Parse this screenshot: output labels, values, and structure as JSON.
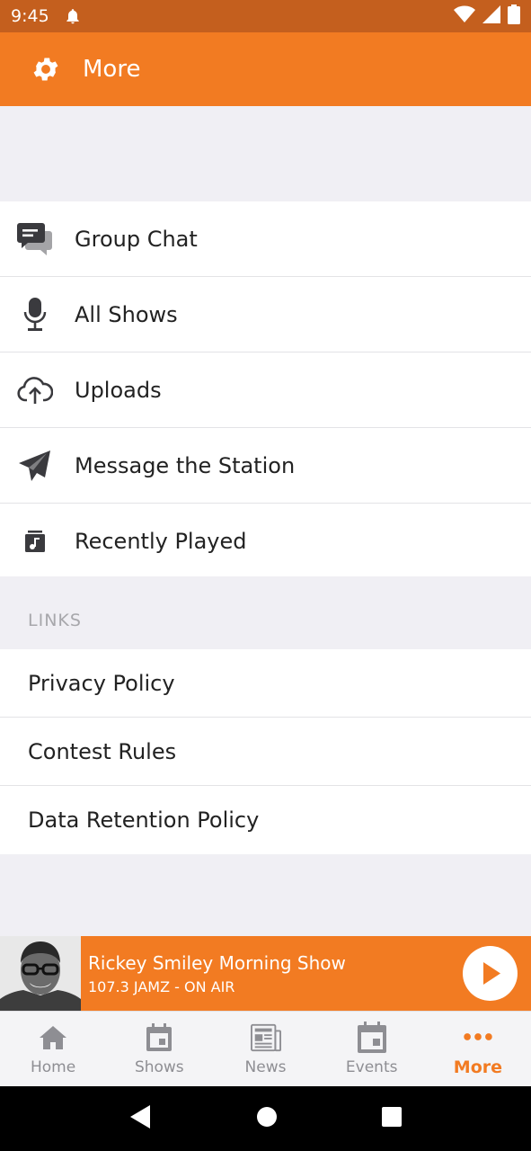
{
  "status": {
    "time": "9:45"
  },
  "header": {
    "title": "More"
  },
  "menu": [
    {
      "label": "Group Chat",
      "icon": "chat-icon"
    },
    {
      "label": "All Shows",
      "icon": "microphone-icon"
    },
    {
      "label": "Uploads",
      "icon": "cloud-upload-icon"
    },
    {
      "label": "Message the Station",
      "icon": "paper-plane-icon"
    },
    {
      "label": "Recently Played",
      "icon": "music-note-icon"
    }
  ],
  "links": {
    "header": "LINKS",
    "items": [
      {
        "label": "Privacy Policy"
      },
      {
        "label": "Contest Rules"
      },
      {
        "label": "Data Retention Policy"
      }
    ]
  },
  "player": {
    "show": "Rickey Smiley Morning Show",
    "station": "107.3 JAMZ - ON AIR"
  },
  "tabs": [
    {
      "label": "Home",
      "icon": "home-icon"
    },
    {
      "label": "Shows",
      "icon": "calendar-icon"
    },
    {
      "label": "News",
      "icon": "newspaper-icon"
    },
    {
      "label": "Events",
      "icon": "calendar-icon"
    },
    {
      "label": "More",
      "icon": "more-dots-icon",
      "active": true
    }
  ],
  "colors": {
    "accent": "#f27b22",
    "status_bar": "#c45f1e"
  }
}
